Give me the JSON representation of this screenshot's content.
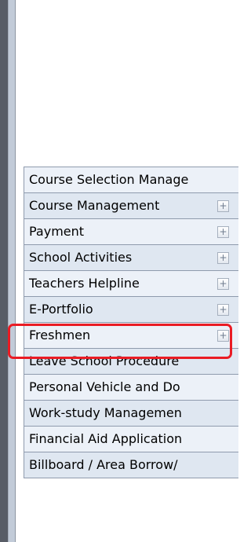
{
  "menu": {
    "items": [
      {
        "label": "Course Selection Manage",
        "expandable": false
      },
      {
        "label": "Course Management",
        "expandable": true,
        "expand_icon": "+"
      },
      {
        "label": "Payment",
        "expandable": true,
        "expand_icon": "+"
      },
      {
        "label": "School Activities",
        "expandable": true,
        "expand_icon": "+"
      },
      {
        "label": "Teachers Helpline",
        "expandable": true,
        "expand_icon": "+"
      },
      {
        "label": "E-Portfolio",
        "expandable": true,
        "expand_icon": "+",
        "highlighted": true
      },
      {
        "label": "Freshmen",
        "expandable": true,
        "expand_icon": "+"
      },
      {
        "label": "Leave School Procedure",
        "expandable": false
      },
      {
        "label": "Personal Vehicle and Do",
        "expandable": false
      },
      {
        "label": "Work-study Managemen",
        "expandable": false
      },
      {
        "label": "Financial Aid Application",
        "expandable": false
      },
      {
        "label": "Billboard / Area Borrow/",
        "expandable": false
      }
    ]
  },
  "colors": {
    "highlight": "#ea1c24",
    "item_background": "#ecf1f8",
    "item_border": "#8f9bad",
    "rail_dark": "#585d66",
    "rail_light": "#c2cbd8"
  },
  "icons": {
    "expand": "plus-box-icon"
  }
}
